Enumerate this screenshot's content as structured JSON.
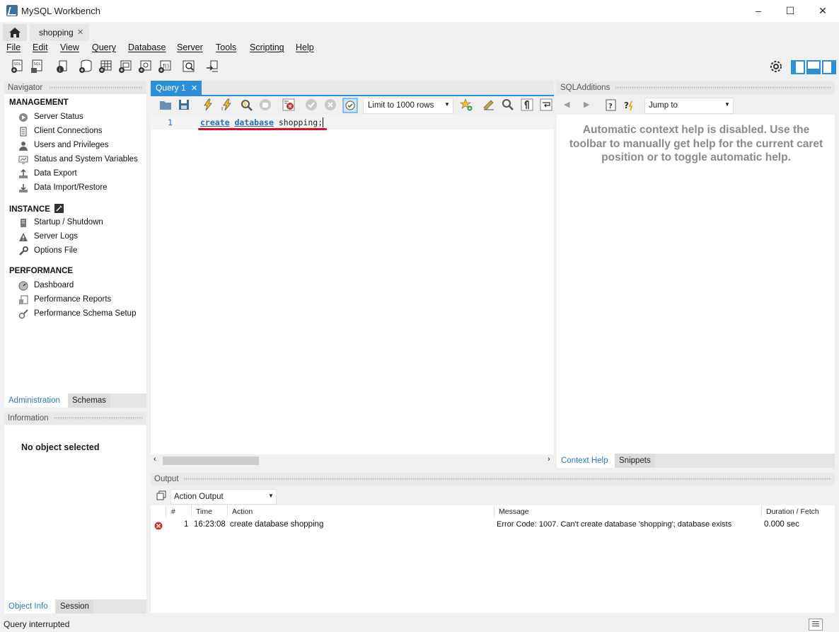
{
  "window": {
    "title": "MySQL Workbench",
    "minimize": "–",
    "maximize": "☐",
    "close": "✕"
  },
  "tabs": {
    "home_icon": "home-icon",
    "connection_tab": "shopping",
    "close_glyph": "✕"
  },
  "menu": [
    "File",
    "Edit",
    "View",
    "Query",
    "Database",
    "Server",
    "Tools",
    "Scripting",
    "Help"
  ],
  "navigator": {
    "header": "Navigator",
    "sections": [
      {
        "title": "MANAGEMENT",
        "items": [
          "Server Status",
          "Client Connections",
          "Users and Privileges",
          "Status and System Variables",
          "Data Export",
          "Data Import/Restore"
        ]
      },
      {
        "title": "INSTANCE",
        "items": [
          "Startup / Shutdown",
          "Server Logs",
          "Options File"
        ]
      },
      {
        "title": "PERFORMANCE",
        "items": [
          "Dashboard",
          "Performance Reports",
          "Performance Schema Setup"
        ]
      }
    ],
    "bottom_tabs": [
      "Administration",
      "Schemas"
    ]
  },
  "information": {
    "header": "Information",
    "empty_text": "No object selected",
    "bottom_tabs": [
      "Object Info",
      "Session"
    ]
  },
  "editor": {
    "tab_label": "Query 1",
    "limit_select": "Limit to 1000 rows",
    "line_number": "1",
    "code_keyword1": "create",
    "code_keyword2": "database",
    "code_ident": "shopping;"
  },
  "sql_additions": {
    "header": "SQLAdditions",
    "jump_to": "Jump to",
    "help_text": "Automatic context help is disabled. Use the toolbar to manually get help for the current caret position or to toggle automatic help.",
    "bottom_tabs": [
      "Context Help",
      "Snippets"
    ]
  },
  "output": {
    "header": "Output",
    "selector": "Action Output",
    "columns": [
      "#",
      "Time",
      "Action",
      "Message",
      "Duration / Fetch"
    ],
    "rows": [
      {
        "num": "1",
        "time": "16:23:08",
        "action": "create database shopping",
        "message": "Error Code: 1007. Can't create database 'shopping'; database exists",
        "duration": "0.000 sec"
      }
    ]
  },
  "status": {
    "text": "Query interrupted"
  },
  "colors": {
    "accent": "#2d8fd9",
    "keyword": "#1f6fb5",
    "error": "#d0312d",
    "underline": "#d8102a"
  }
}
